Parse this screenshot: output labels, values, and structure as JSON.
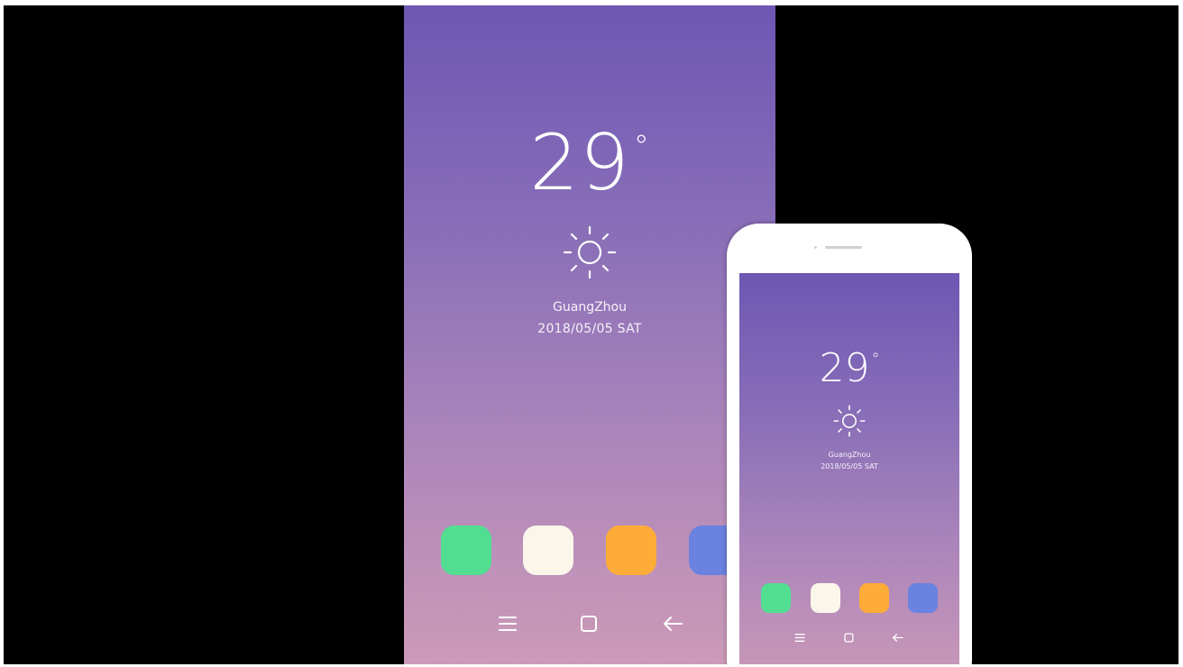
{
  "weather": {
    "temperature": "29",
    "degree_symbol": "°",
    "condition_icon": "sun-icon",
    "city": "GuangZhou",
    "date": "2018/05/05 SAT"
  },
  "apps": [
    {
      "name": "app-green",
      "color": "#52de91"
    },
    {
      "name": "app-cream",
      "color": "#fbf6ea"
    },
    {
      "name": "app-orange",
      "color": "#feac38"
    },
    {
      "name": "app-blue",
      "color": "#6a82e0"
    }
  ],
  "navigation": {
    "menu_icon": "menu-icon",
    "home_icon": "home-square-icon",
    "back_icon": "back-arrow-icon"
  },
  "colors": {
    "background": "#000000",
    "gradient_top": "#6d57b3",
    "gradient_bottom": "#cc9ab8",
    "phone_body": "#ffffff"
  }
}
